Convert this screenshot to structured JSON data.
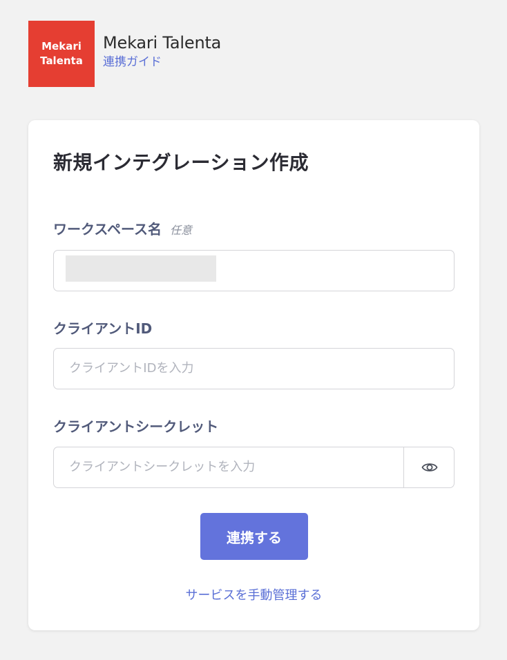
{
  "header": {
    "logo_line1": "Mekari",
    "logo_line2": "Talenta",
    "app_name": "Mekari Talenta",
    "guide_link": "連携ガイド"
  },
  "form": {
    "title": "新規インテグレーション作成",
    "workspace": {
      "label": "ワークスペース名",
      "optional": "任意",
      "value": ""
    },
    "client_id": {
      "label": "クライアントID",
      "placeholder": "クライアントIDを入力"
    },
    "client_secret": {
      "label": "クライアントシークレット",
      "placeholder": "クライアントシークレットを入力",
      "toggle_icon": "eye-icon"
    },
    "submit_label": "連携する",
    "manual_link": "サービスを手動管理する"
  },
  "colors": {
    "brand": "#e53e32",
    "accent": "#6373dc",
    "link": "#5a6fd6",
    "background": "#f2f2f2"
  }
}
